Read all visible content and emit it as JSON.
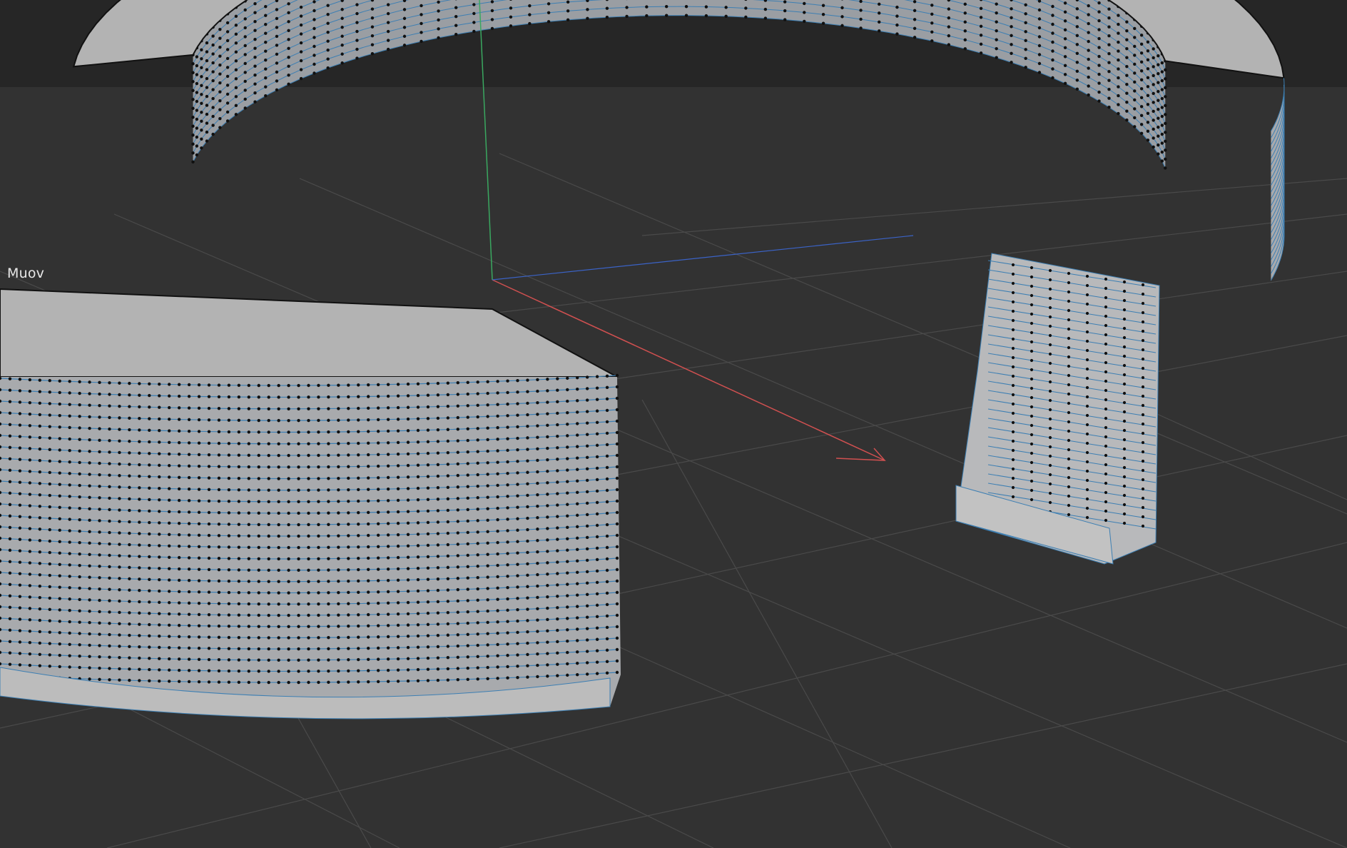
{
  "viewport": {
    "object_label": "Muov",
    "colors": {
      "background": "#323232",
      "header_band": "#262626",
      "grid_line": "#4a4a4a",
      "mesh_fill": "#b3b3b3",
      "mesh_side": "#a8aaad",
      "edge_line": "#3d7fb3",
      "vertex": "#101010",
      "axis_x": "#d05050",
      "axis_y": "#3aa860",
      "axis_z": "#3b63c7"
    },
    "icons": [
      "axis-x-arrow-icon"
    ]
  }
}
